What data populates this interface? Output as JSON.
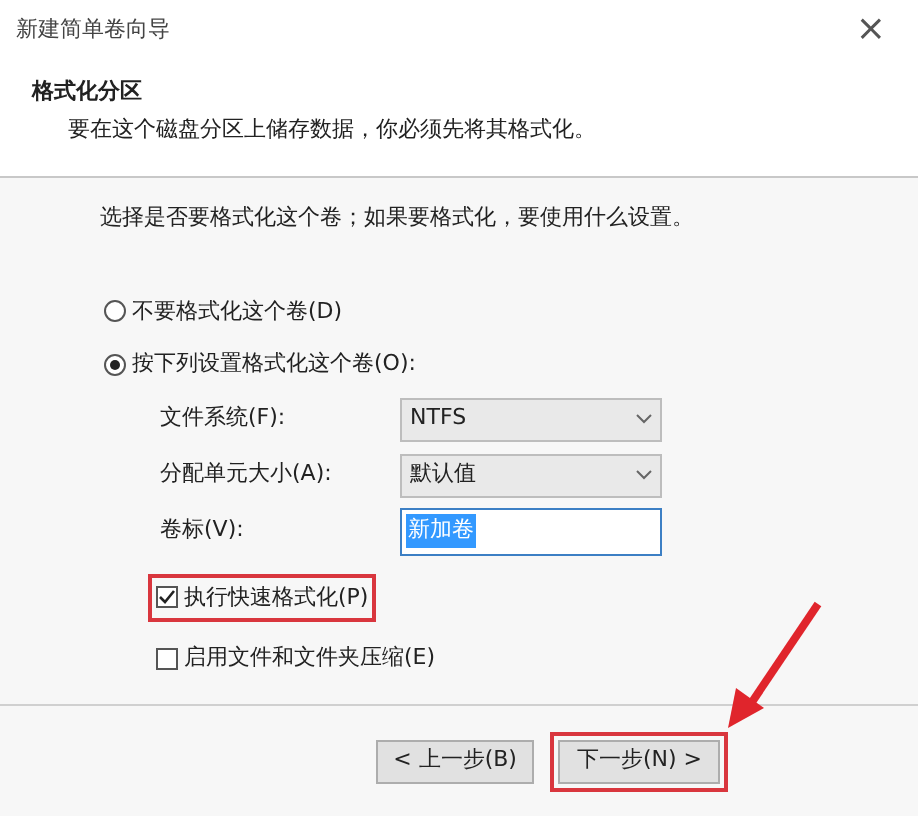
{
  "window": {
    "title": "新建简单卷向导",
    "close": "×"
  },
  "header": {
    "title": "格式化分区",
    "subtitle": "要在这个磁盘分区上储存数据，你必须先将其格式化。"
  },
  "prompt": "选择是否要格式化这个卷；如果要格式化，要使用什么设置。",
  "options": [
    {
      "label": "不要格式化这个卷(D)",
      "selected": false
    },
    {
      "label": "按下列设置格式化这个卷(O):",
      "selected": true
    }
  ],
  "fields": [
    {
      "kind": "dropdown",
      "label": "文件系统(F):",
      "value": "NTFS"
    },
    {
      "kind": "dropdown",
      "label": "分配单元大小(A):",
      "value": "默认值"
    },
    {
      "kind": "text",
      "label": "卷标(V):",
      "value": "新加卷"
    }
  ],
  "checkboxes": [
    {
      "label": "执行快速格式化(P)",
      "checked": true,
      "highlighted": true
    },
    {
      "label": "启用文件和文件夹压缩(E)",
      "checked": false,
      "highlighted": false
    }
  ],
  "buttons": [
    {
      "label": "< 上一步(B)",
      "highlighted": false
    },
    {
      "label": "下一步(N) >",
      "highlighted": true
    }
  ]
}
